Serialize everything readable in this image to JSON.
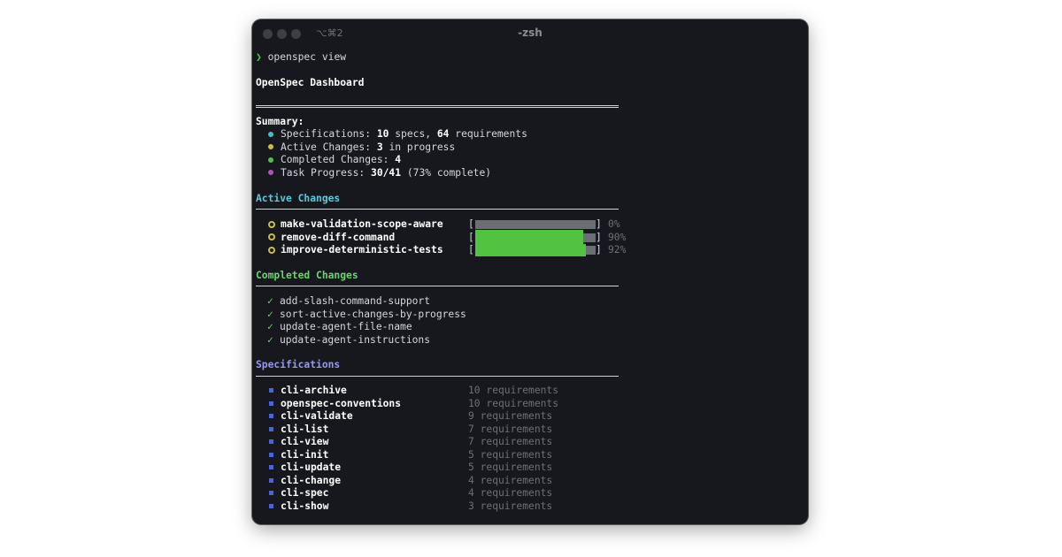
{
  "window": {
    "title": "-zsh",
    "shortcut": "⌥⌘2"
  },
  "prompt": {
    "symbol": "❯",
    "command": "openspec view"
  },
  "dashboard_title": "OpenSpec Dashboard",
  "summary": {
    "heading": "Summary:",
    "items": [
      {
        "label": "Specifications: ",
        "v1": "10",
        "mid": " specs, ",
        "v2": "64",
        "tail": " requirements",
        "color": "#3ec1cf"
      },
      {
        "label": "Active Changes: ",
        "v1": "3",
        "mid": " in progress",
        "v2": "",
        "tail": "",
        "color": "#c9c043"
      },
      {
        "label": "Completed Changes: ",
        "v1": "4",
        "mid": "",
        "v2": "",
        "tail": "",
        "color": "#52c241"
      },
      {
        "label": "Task Progress: ",
        "v1": "30/41",
        "mid": " (73% complete)",
        "v2": "",
        "tail": "",
        "color": "#b54fc6"
      }
    ]
  },
  "active_changes": {
    "heading": "Active Changes",
    "open_bracket": "[",
    "close_bracket": "]",
    "items": [
      {
        "name": "make-validation-scope-aware",
        "percent": "0%",
        "progress": 0.0
      },
      {
        "name": "remove-diff-command",
        "percent": "90%",
        "progress": 0.9
      },
      {
        "name": "improve-deterministic-tests",
        "percent": "92%",
        "progress": 0.92
      }
    ]
  },
  "completed_changes": {
    "heading": "Completed Changes",
    "check": "✓",
    "items": [
      "add-slash-command-support",
      "sort-active-changes-by-progress",
      "update-agent-file-name",
      "update-agent-instructions"
    ]
  },
  "specifications": {
    "heading": "Specifications",
    "items": [
      {
        "name": "cli-archive",
        "requirements": "10 requirements"
      },
      {
        "name": "openspec-conventions",
        "requirements": "10 requirements"
      },
      {
        "name": "cli-validate",
        "requirements": "9 requirements"
      },
      {
        "name": "cli-list",
        "requirements": "7 requirements"
      },
      {
        "name": "cli-view",
        "requirements": "7 requirements"
      },
      {
        "name": "cli-init",
        "requirements": "5 requirements"
      },
      {
        "name": "cli-update",
        "requirements": "5 requirements"
      },
      {
        "name": "cli-change",
        "requirements": "4 requirements"
      },
      {
        "name": "cli-spec",
        "requirements": "4 requirements"
      },
      {
        "name": "cli-show",
        "requirements": "3 requirements"
      }
    ]
  }
}
